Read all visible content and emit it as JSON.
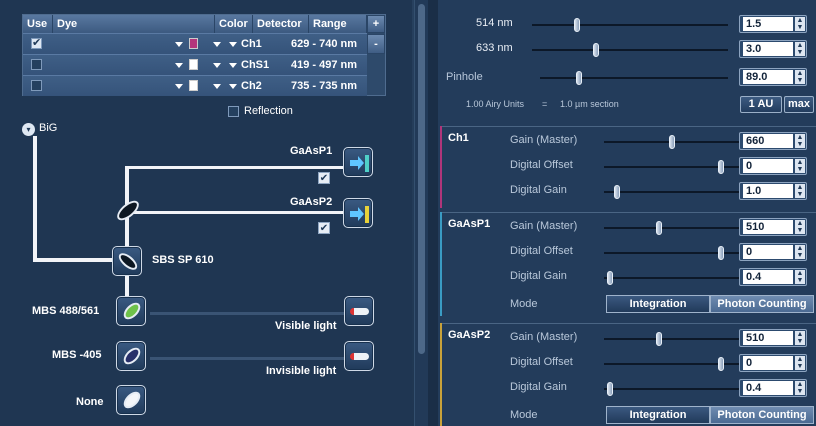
{
  "dye_table": {
    "headers": {
      "use": "Use",
      "dye": "Dye",
      "color": "Color",
      "detector": "Detector",
      "range": "Range"
    },
    "add_button": "+",
    "remove_button": "-",
    "rows": [
      {
        "checked": true,
        "color": "#b4367c",
        "detector": "Ch1",
        "range": "629 - 740 nm"
      },
      {
        "checked": false,
        "color": "#ffffff",
        "detector": "ChS1",
        "range": "419 - 497 nm"
      },
      {
        "checked": false,
        "color": "#ffffff",
        "detector": "Ch2",
        "range": "735 - 735 nm"
      }
    ],
    "reflection_label": "Reflection"
  },
  "light_path": {
    "big_label": "BiG",
    "gaasp1_label": "GaAsP1",
    "gaasp2_label": "GaAsP2",
    "sbs_label": "SBS SP 610",
    "mbs1_label": "MBS 488/561",
    "mbs2_label": "MBS -405",
    "none_label": "None",
    "visible_label": "Visible light",
    "invisible_label": "Invisible light"
  },
  "lasers": [
    {
      "label": "514 nm",
      "value": "1.5",
      "level": 0.22
    },
    {
      "label": "633 nm",
      "value": "3.0",
      "level": 0.32
    }
  ],
  "pinhole": {
    "label": "Pinhole",
    "value": "89.0",
    "level": 0.2,
    "info_units": "1.00 Airy Units",
    "info_eq": "=",
    "info_section": "1.0 µm section",
    "au_button": "1 AU",
    "max_button": "max"
  },
  "channels": [
    {
      "name": "Ch1",
      "accent": "#b0357a",
      "gain_label": "Gain (Master)",
      "gain": "660",
      "gain_level": 0.5,
      "offset_label": "Digital Offset",
      "offset": "0",
      "offset_level": 0.88,
      "dgain_label": "Digital Gain",
      "dgain": "1.0",
      "dgain_level": 0.08
    },
    {
      "name": "GaAsP1",
      "accent": "#3a9cc4",
      "gain_label": "Gain (Master)",
      "gain": "510",
      "gain_level": 0.4,
      "offset_label": "Digital Offset",
      "offset": "0",
      "offset_level": 0.88,
      "dgain_label": "Digital Gain",
      "dgain": "0.4",
      "dgain_level": 0.02,
      "mode_label": "Mode",
      "mode_a": "Integration",
      "mode_b": "Photon Counting"
    },
    {
      "name": "GaAsP2",
      "accent": "#c9a23a",
      "gain_label": "Gain (Master)",
      "gain": "510",
      "gain_level": 0.4,
      "offset_label": "Digital Offset",
      "offset": "0",
      "offset_level": 0.88,
      "dgain_label": "Digital Gain",
      "dgain": "0.4",
      "dgain_level": 0.02,
      "mode_label": "Mode",
      "mode_a": "Integration",
      "mode_b": "Photon Counting"
    }
  ]
}
